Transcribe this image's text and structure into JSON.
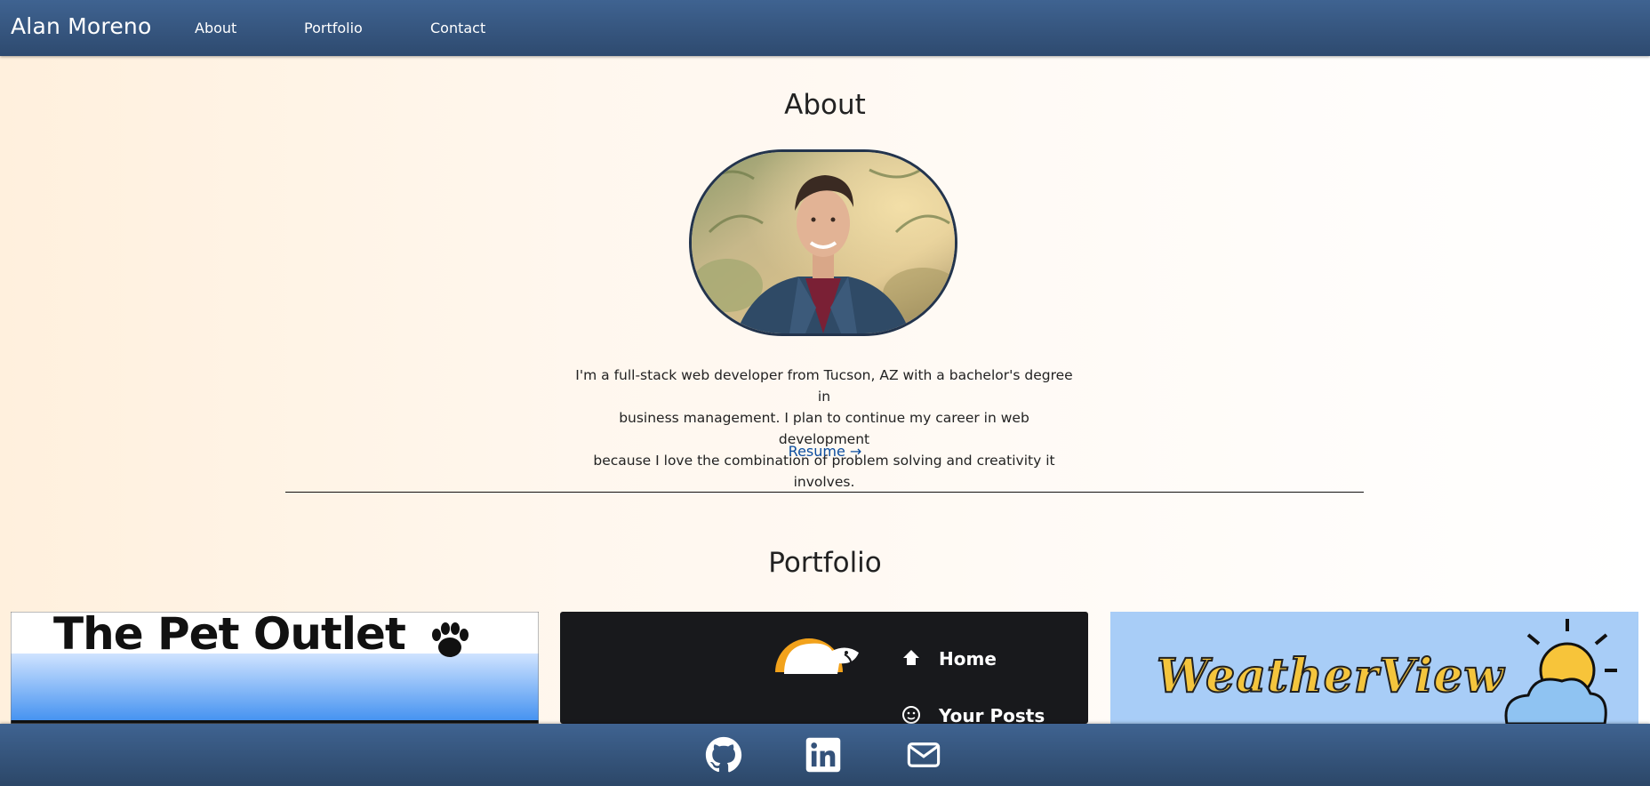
{
  "nav": {
    "brand": "Alan Moreno",
    "links": [
      "About",
      "Portfolio",
      "Contact"
    ]
  },
  "about": {
    "title": "About",
    "photo_alt": "Portrait of Alan Moreno",
    "bio_lines": [
      "I'm a full-stack web developer from Tucson, AZ with a bachelor's degree in",
      "business management. I plan to continue my career in web development",
      "because I love the combination of problem solving and creativity it involves."
    ],
    "resume_label": "Resume",
    "resume_arrow": "→"
  },
  "portfolio": {
    "title": "Portfolio",
    "projects": [
      {
        "title": "The Pet Outlet"
      },
      {
        "menu": [
          "Home",
          "Your Posts"
        ]
      },
      {
        "title": "WeatherView"
      }
    ]
  },
  "footer": {
    "icons": [
      "github-icon",
      "linkedin-icon",
      "email-icon"
    ]
  },
  "colors": {
    "nav_bg": "#34527a",
    "link": "#0b4d9f",
    "photo_border": "#23344d"
  }
}
